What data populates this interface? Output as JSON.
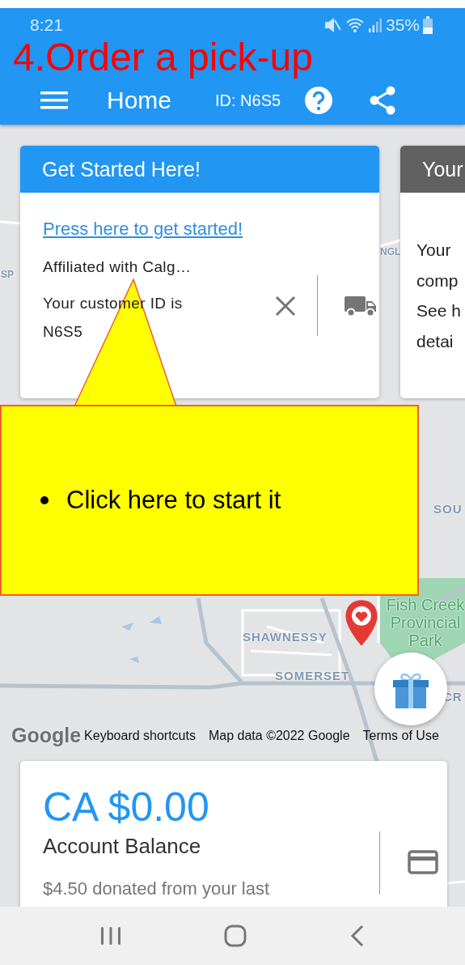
{
  "status_bar": {
    "time": "8:21",
    "battery": "35%"
  },
  "app_bar": {
    "title": "Home",
    "customer_id": "ID: N6S5"
  },
  "annotation": {
    "title": "4.Order a pick-up",
    "bullets": [
      "Click here to start it"
    ]
  },
  "start_card": {
    "header": "Get Started Here!",
    "link": "Press here to get started!",
    "affiliation": "Affiliated with Calg…",
    "customer_id": "Your customer ID is N6S5"
  },
  "info_card": {
    "header": "Your",
    "lines": [
      "Your",
      "comp",
      "See h",
      "detai"
    ]
  },
  "map": {
    "labels": [
      "SP",
      "NGL",
      "SOU",
      "SHAWNESSY",
      "SOMERSET",
      "Fish Creek Provincial Park",
      "CR"
    ],
    "attribution": {
      "logo": "Google",
      "shortcuts": "Keyboard shortcuts",
      "data": "Map data ©2022 Google",
      "terms": "Terms of Use"
    }
  },
  "balance_card": {
    "amount": "CA $0.00",
    "label": "Account Balance",
    "note": "$4.50 donated from your last"
  }
}
